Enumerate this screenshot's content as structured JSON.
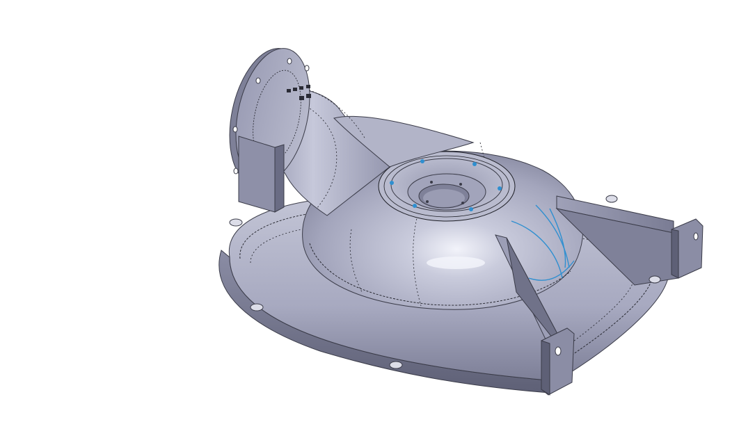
{
  "viewport": {
    "background": "#ffffff",
    "model": {
      "name": "volute-pump-casing",
      "body_color": "#a7a9c0",
      "shadow_color": "#6f7189",
      "highlight_color": "#eceef6",
      "edge_color": "#1c1d24",
      "sketch_color": "#2f8fd0"
    }
  }
}
